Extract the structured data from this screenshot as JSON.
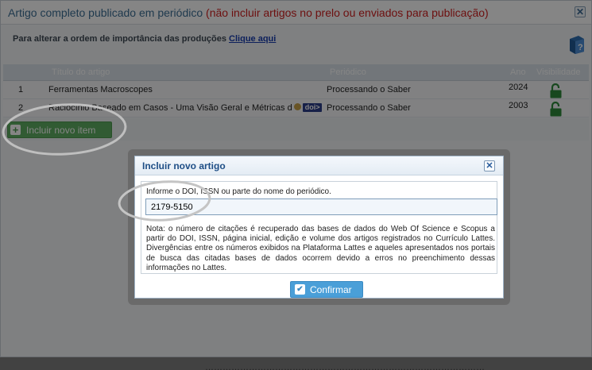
{
  "window": {
    "title": "Artigo completo publicado em periódico",
    "title_warning": "(não incluir artigos no prelo ou enviados para publicação)",
    "close_glyph": "✕"
  },
  "hint": {
    "text": "Para alterar a ordem de importância das produções",
    "link": "Clique aqui"
  },
  "table": {
    "headers": {
      "title": "Título do artigo",
      "journal": "Periódico",
      "year": "Ano",
      "visibility": "Visibilidade"
    },
    "rows": [
      {
        "num": "1",
        "title": "Ferramentas Macroscopes",
        "journal": "Processando o Saber",
        "year": "2024"
      },
      {
        "num": "2",
        "title": "Raciocínio Baseado em Casos - Uma Visão Geral e Métricas d",
        "badge": "doi>",
        "journal": "Processando o Saber",
        "year": "2003"
      }
    ]
  },
  "add_button": {
    "label": "Incluir novo item",
    "icon": "plus-icon"
  },
  "dialog": {
    "title": "Incluir novo artigo",
    "close_glyph": "✕",
    "label": "Informe o DOI, ISSN ou parte do nome do periódico.",
    "input_value": "2179-5150",
    "note": "Nota: o número de citações é recuperado das bases de dados do Web Of Science e Scopus a partir do DOI, ISSN, página inicial, edição e volume dos artigos registrados no Currículo Lattes. Divergências entre os números exibidos na Plataforma Lattes e aqueles apresentados nos portais de busca das citadas bases de dados ocorrem devido a erros no preenchimento dessas informações no Lattes.",
    "confirm_label": "Confirmar",
    "confirm_icon": "check-icon"
  },
  "colors": {
    "title": "#3d6f96",
    "warning": "#d21f1f",
    "add_button": "#5fae62",
    "confirm_button": "#4a9fd8",
    "lock": "#2e8b3a"
  }
}
